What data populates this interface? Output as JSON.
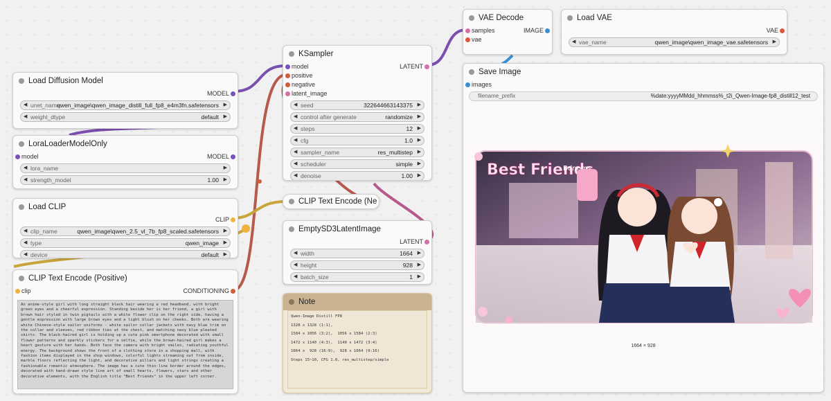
{
  "colors": {
    "model": "#7a4fbf",
    "clip": "#f2b33d",
    "cond": "#d25b3a",
    "latent": "#d470a8",
    "vae": "#e0553d",
    "image": "#3a8fd3",
    "link_purple": "#7b4fb0",
    "link_red": "#b65a4b",
    "link_yellow": "#c8a43c",
    "link_blue": "#3a8fd3"
  },
  "nodes": {
    "load_diffusion": {
      "title": "Load Diffusion Model",
      "out": "MODEL",
      "w1": {
        "label": "unet_name",
        "value": "qwen_image\\qwen_image_distill_full_fp8_e4m3fn.safetensors"
      },
      "w2": {
        "label": "weight_dtype",
        "value": "default"
      }
    },
    "lora": {
      "title": "LoraLoaderModelOnly",
      "in": "model",
      "out": "MODEL",
      "w1": {
        "label": "lora_name",
        "value": ""
      },
      "w2": {
        "label": "strength_model",
        "value": "1.00"
      }
    },
    "load_clip": {
      "title": "Load CLIP",
      "out": "CLIP",
      "w1": {
        "label": "clip_name",
        "value": "qwen_image\\qwen_2.5_vl_7b_fp8_scaled.safetensors"
      },
      "w2": {
        "label": "type",
        "value": "qwen_image"
      },
      "w3": {
        "label": "device",
        "value": "default"
      }
    },
    "clip_pos": {
      "title": "CLIP Text Encode (Positive)",
      "in": "clip",
      "out": "CONDITIONING",
      "text": "An anime-style girl with long straight black hair wearing a red headband, with bright green eyes and a cheerful expression. Standing beside her is her friend, a girl with brown hair styled in twin pigtails with a white flower clip on the right side, having a gentle expression with large brown eyes and a light blush on her cheeks. Both are wearing white Chinese-style sailor uniforms - white sailor collar jackets with navy blue trim on the collar and sleeves, red ribbon ties at the chest, and matching navy blue pleated skirts. The black-haired girl is holding up a cute pink smartphone decorated with small flower patterns and sparkly stickers for a selfie, while the brown-haired girl makes a heart gesture with her hands. Both face the camera with bright smiles, radiating youthful energy. The background shows the front of a clothing store in a shopping mall, with fashion items displayed in the shop windows, colorful lights streaming out from inside, marble floors reflecting the light, and decorative pillars and light strings creating a fashionable romantic atmosphere. The image has a cute thin-line border around the edges, decorated with hand-drawn style line art of small hearts, flowers, stars and other decorative elements, with the English title \"Best Friends\" in the upper left corner."
    },
    "ksampler": {
      "title": "KSampler",
      "inputs": [
        "model",
        "positive",
        "negative",
        "latent_image"
      ],
      "out": "LATENT",
      "widgets": [
        {
          "label": "seed",
          "value": "322644663143375"
        },
        {
          "label": "control after generate",
          "value": "randomize"
        },
        {
          "label": "steps",
          "value": "12"
        },
        {
          "label": "cfg",
          "value": "1.0"
        },
        {
          "label": "sampler_name",
          "value": "res_multistep"
        },
        {
          "label": "scheduler",
          "value": "simple"
        },
        {
          "label": "denoise",
          "value": "1.00"
        }
      ]
    },
    "clip_neg": {
      "title": "CLIP Text Encode (Ne"
    },
    "empty_latent": {
      "title": "EmptySD3LatentImage",
      "out": "LATENT",
      "widgets": [
        {
          "label": "width",
          "value": "1664"
        },
        {
          "label": "height",
          "value": "928"
        },
        {
          "label": "batch_size",
          "value": "1"
        }
      ]
    },
    "note": {
      "title": "Note",
      "lines": [
        "Qwen-Image Distill FP8",
        "1328 x 1328 (1:1),",
        "1584 x 1056 (3:2),  1056 x 1584 (2:3)",
        "1472 x 1140 (4:3),  1140 x 1472 (3:4)",
        "1664 x  928 (16:9),  928 x 1664 (9:16)",
        "Steps 15~10, CFG 1.0, res_multistep/simple"
      ]
    },
    "vae_decode": {
      "title": "VAE Decode",
      "in1": "samples",
      "in2": "vae",
      "out": "IMAGE"
    },
    "load_vae": {
      "title": "Load VAE",
      "out": "VAE",
      "w1": {
        "label": "vae_name",
        "value": "qwen_image\\qwen_image_vae.safetensors"
      }
    },
    "save_image": {
      "title": "Save Image",
      "in": "images",
      "w1": {
        "label": "filename_prefix",
        "value": "%date:yyyyMMdd_hhmmss%_t2i_Qwen-Image-fp8_distill12_test"
      },
      "image_title": "Best Friends",
      "store_sign": "Bdnems",
      "caption": "1664 × 928"
    }
  }
}
